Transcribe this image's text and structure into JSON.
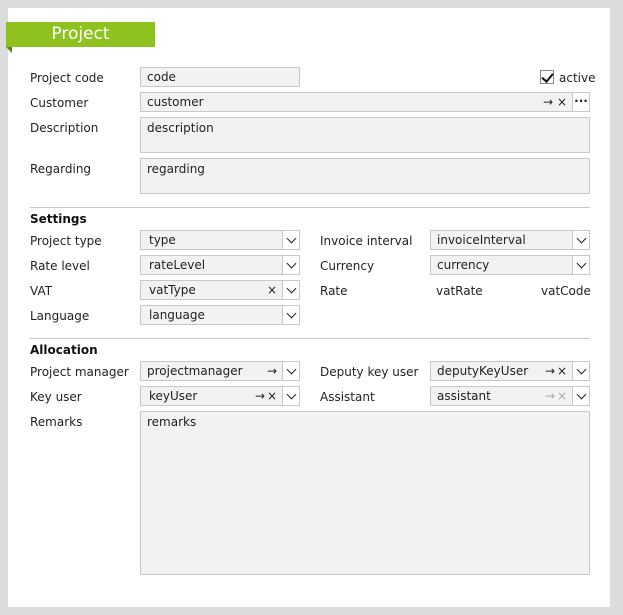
{
  "title": "Project",
  "top": {
    "project_code": {
      "label": "Project code",
      "value": "code"
    },
    "active": {
      "label": "active",
      "checked": true
    },
    "customer": {
      "label": "Customer",
      "value": "customer"
    },
    "description": {
      "label": "Description",
      "value": "description"
    },
    "regarding": {
      "label": "Regarding",
      "value": "regarding"
    }
  },
  "settings": {
    "heading": "Settings",
    "project_type": {
      "label": "Project type",
      "value": "type"
    },
    "rate_level": {
      "label": "Rate level",
      "value": "rateLevel"
    },
    "vat": {
      "label": "VAT",
      "value": "vatType"
    },
    "language": {
      "label": "Language",
      "value": "language"
    },
    "invoice_interval": {
      "label": "Invoice interval",
      "value": "invoiceInterval"
    },
    "currency": {
      "label": "Currency",
      "value": "currency"
    },
    "rate": {
      "label": "Rate",
      "value": "vatRate",
      "code": "vatCode"
    }
  },
  "allocation": {
    "heading": "Allocation",
    "project_manager": {
      "label": "Project manager",
      "value": "projectmanager"
    },
    "key_user": {
      "label": "Key user",
      "value": "keyUser"
    },
    "deputy_key_user": {
      "label": "Deputy key user",
      "value": "deputyKeyUser"
    },
    "assistant": {
      "label": "Assistant",
      "value": "assistant"
    },
    "remarks": {
      "label": "Remarks",
      "value": "remarks"
    }
  },
  "glyphs": {
    "arrow": "→",
    "clear": "×",
    "more": "···"
  },
  "colors": {
    "accent": "#8dc21f",
    "field_bg": "#f2f2f2",
    "border": "#c8c8c8"
  }
}
